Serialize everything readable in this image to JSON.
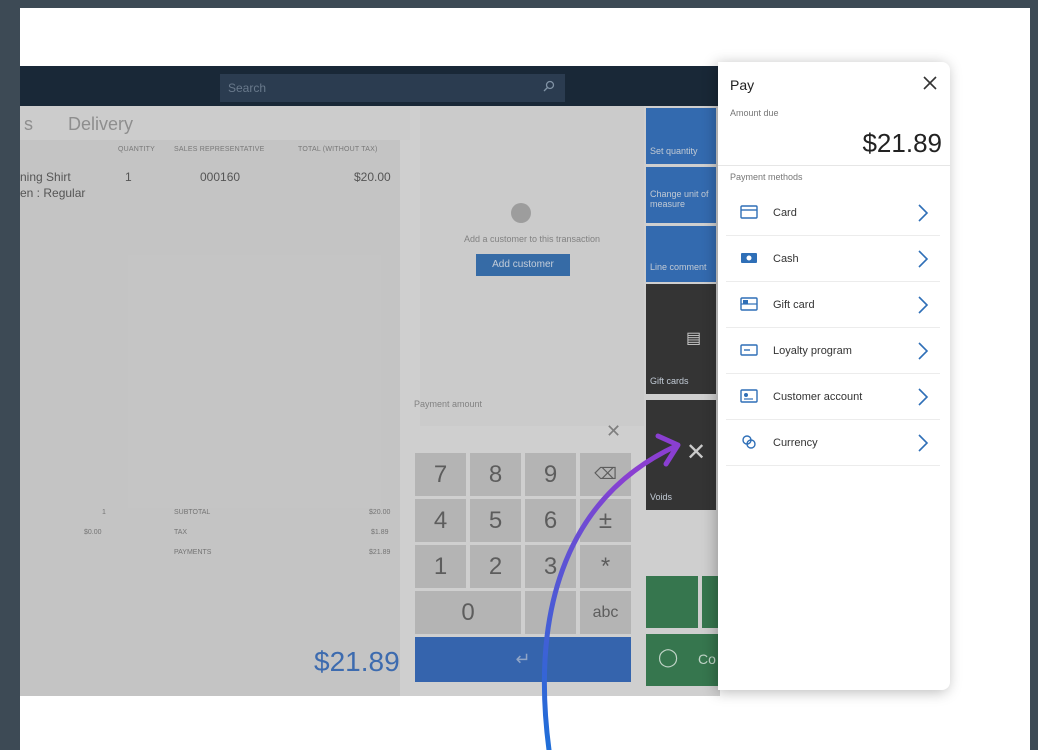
{
  "search": {
    "placeholder": "Search"
  },
  "tabs": [
    {
      "label": "s"
    },
    {
      "label": "Delivery"
    }
  ],
  "grid": {
    "headers": {
      "quantity": "QUANTITY",
      "sales_rep": "SALES REPRESENTATIVE",
      "total": "TOTAL (WITHOUT TAX)"
    },
    "rows": [
      {
        "product": "ning Shirt",
        "variant": "en : Regular",
        "quantity": "1",
        "sales_rep": "000160",
        "total": "$20.00"
      }
    ]
  },
  "customer": {
    "prompt": "Add a customer to this transaction",
    "add_button": "Add customer"
  },
  "numpad": {
    "label": "Payment amount",
    "keys": [
      "7",
      "8",
      "9",
      "⌫",
      "4",
      "5",
      "6",
      "±",
      "1",
      "2",
      "3",
      "*",
      "0",
      ".",
      "abc"
    ],
    "enter": "↵"
  },
  "actions": {
    "set_quantity": "Set quantity",
    "change_unit": "Change unit of measure",
    "line_comment": "Line comment",
    "gift_cards": "Gift cards",
    "voids": "Voids",
    "complete_partial": "Co"
  },
  "totals": {
    "items_count": "1",
    "discount": "$0.00",
    "subtotal_label": "SUBTOTAL",
    "subtotal_value": "$20.00",
    "tax_label": "TAX",
    "tax_value": "$1.89",
    "payments_label": "PAYMENTS",
    "payments_value": "$21.89",
    "amount_due": "$21.89"
  },
  "pay": {
    "title": "Pay",
    "amount_due_label": "Amount due",
    "amount_due_value": "$21.89",
    "methods_label": "Payment methods",
    "methods": [
      {
        "label": "Card",
        "icon": "card-icon"
      },
      {
        "label": "Cash",
        "icon": "cash-icon"
      },
      {
        "label": "Gift card",
        "icon": "gift-card-icon"
      },
      {
        "label": "Loyalty program",
        "icon": "loyalty-icon"
      },
      {
        "label": "Customer account",
        "icon": "customer-account-icon"
      },
      {
        "label": "Currency",
        "icon": "currency-icon"
      }
    ]
  },
  "colors": {
    "accent_blue": "#2f6fb7",
    "arrow_gradient_start": "#1e6fd8",
    "arrow_gradient_end": "#8a3fd1",
    "action_tile": "#2b6ec2",
    "dark_tile": "#2c2c2c",
    "green_tile": "#2f7d4c"
  }
}
